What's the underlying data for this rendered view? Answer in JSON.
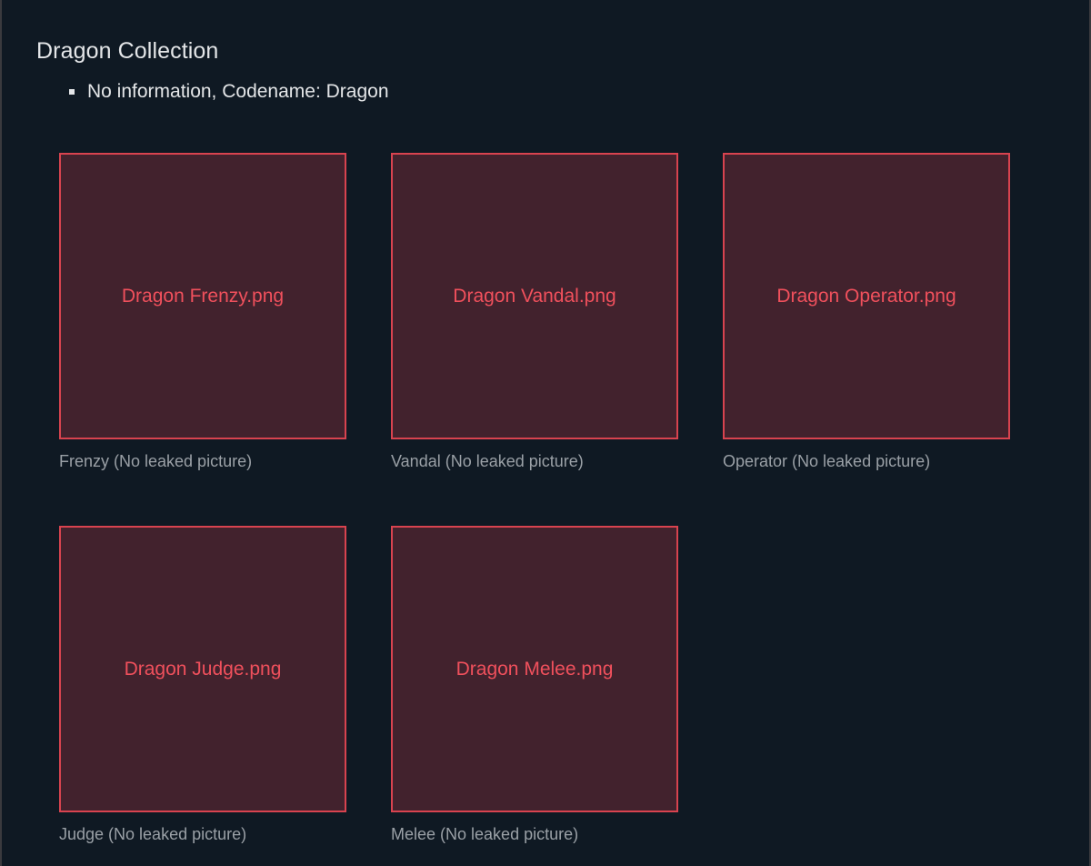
{
  "section": {
    "title": "Dragon Collection",
    "info": "No information, Codename: Dragon"
  },
  "colors": {
    "background": "#0f1923",
    "card_border": "#d8434f",
    "card_fill": "#42222d",
    "card_text": "#f0505c",
    "caption_text": "#9aa0a6",
    "title_text": "#e4e6e8"
  },
  "cards": [
    {
      "image_label": "Dragon Frenzy.png",
      "caption": "Frenzy (No leaked picture)"
    },
    {
      "image_label": "Dragon Vandal.png",
      "caption": "Vandal (No leaked picture)"
    },
    {
      "image_label": "Dragon Operator.png",
      "caption": "Operator (No leaked picture)"
    },
    {
      "image_label": "Dragon Judge.png",
      "caption": "Judge (No leaked picture)"
    },
    {
      "image_label": "Dragon Melee.png",
      "caption": "Melee (No leaked picture)"
    }
  ]
}
